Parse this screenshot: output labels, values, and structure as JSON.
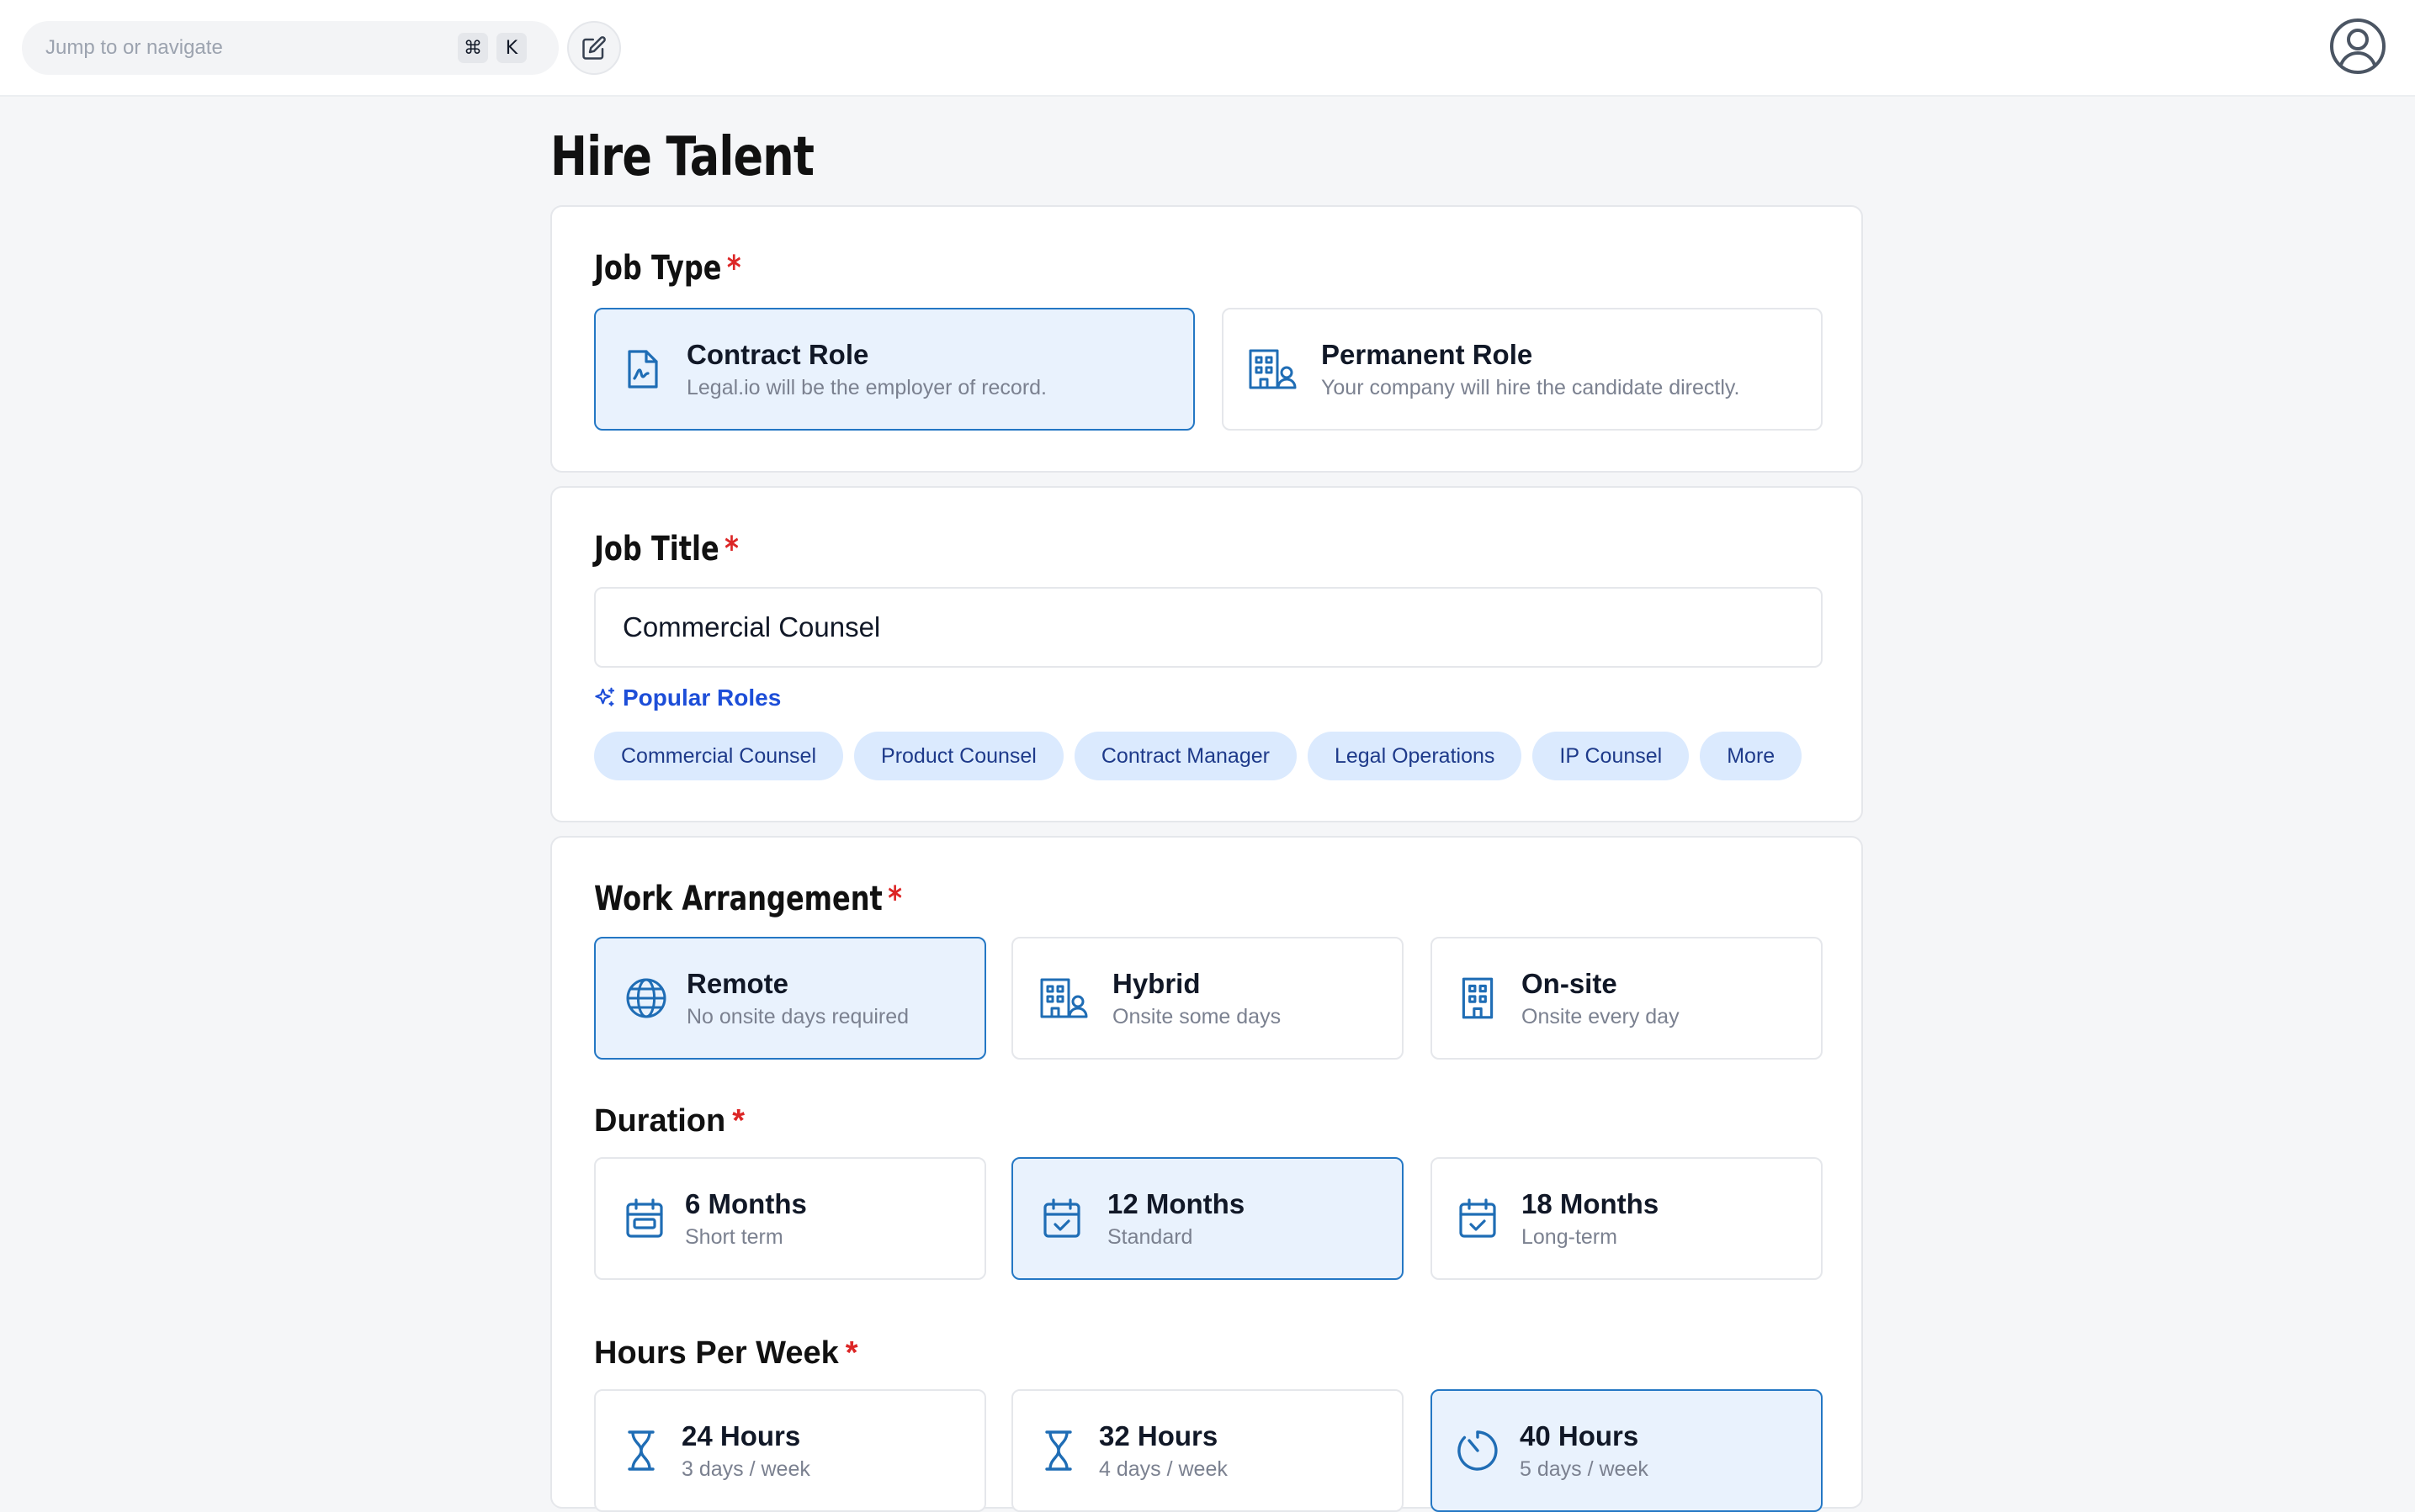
{
  "topbar": {
    "search_placeholder": "Jump to or navigate",
    "shortcut_mod": "⌘",
    "shortcut_key": "K"
  },
  "page": {
    "title": "Hire Talent"
  },
  "job_type": {
    "label": "Job Type",
    "required_mark": "*",
    "options": [
      {
        "title": "Contract Role",
        "subtitle": "Legal.io will be the employer of record.",
        "selected": true,
        "icon": "contract-icon"
      },
      {
        "title": "Permanent Role",
        "subtitle": "Your company will hire the candidate directly.",
        "selected": false,
        "icon": "building-person-icon"
      }
    ]
  },
  "job_title": {
    "label": "Job Title",
    "required_mark": "*",
    "value": "Commercial Counsel",
    "popular_label": "Popular Roles",
    "chips": [
      "Commercial Counsel",
      "Product Counsel",
      "Contract Manager",
      "Legal Operations",
      "IP Counsel",
      "More"
    ]
  },
  "work_arrangement": {
    "label": "Work Arrangement",
    "required_mark": "*",
    "options": [
      {
        "title": "Remote",
        "subtitle": "No onsite days required",
        "selected": true,
        "icon": "globe-icon"
      },
      {
        "title": "Hybrid",
        "subtitle": "Onsite some days",
        "selected": false,
        "icon": "building-person-icon"
      },
      {
        "title": "On-site",
        "subtitle": "Onsite every day",
        "selected": false,
        "icon": "building-icon"
      }
    ]
  },
  "duration": {
    "label": "Duration",
    "required_mark": "*",
    "options": [
      {
        "title": "6 Months",
        "subtitle": "Short term",
        "selected": false,
        "icon": "calendar-icon"
      },
      {
        "title": "12 Months",
        "subtitle": "Standard",
        "selected": true,
        "icon": "calendar-check-icon"
      },
      {
        "title": "18 Months",
        "subtitle": "Long-term",
        "selected": false,
        "icon": "calendar-check-icon"
      }
    ]
  },
  "hours": {
    "label": "Hours Per Week",
    "required_mark": "*",
    "options": [
      {
        "title": "24 Hours",
        "subtitle": "3 days / week",
        "selected": false,
        "icon": "hourglass-icon"
      },
      {
        "title": "32 Hours",
        "subtitle": "4 days / week",
        "selected": false,
        "icon": "hourglass-icon"
      },
      {
        "title": "40 Hours",
        "subtitle": "5 days / week",
        "selected": true,
        "icon": "timer-icon"
      }
    ]
  },
  "colors": {
    "accent": "#2477c4",
    "selected_bg": "#e9f2fd",
    "required": "#dc2626",
    "chip_bg": "#dbeafe"
  }
}
